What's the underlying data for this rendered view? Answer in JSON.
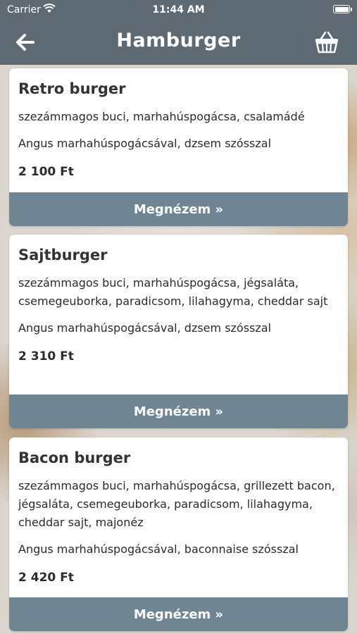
{
  "status_bar": {
    "carrier": "Carrier",
    "time": "11:44 AM"
  },
  "header": {
    "title": "Hamburger",
    "back_icon": "arrow-left-icon",
    "cart_icon": "basket-icon",
    "background_color": "#5d6a73"
  },
  "accent_button_color": "#6f8594",
  "products": [
    {
      "name": "Retro burger",
      "ingredients": "szezámmagos buci, marhahúspogácsa, csalamádé",
      "description": "Angus marhahúspogácsával, dzsem szósszal",
      "price": "2 100 Ft",
      "button_label": "Megnézem »"
    },
    {
      "name": "Sajtburger",
      "ingredients": "szezámmagos buci, marhahúspogácsa, jégsaláta, csemegeuborka, paradicsom, lilahagyma, cheddar sajt",
      "description": "Angus marhahúspogácsával, dzsem szósszal",
      "price": "2 310 Ft",
      "button_label": "Megnézem »"
    },
    {
      "name": "Bacon burger",
      "ingredients": "szezámmagos buci, marhahúspogácsa, grillezett bacon, jégsaláta, csemegeuborka, paradicsom, lilahagyma, cheddar sajt, majonéz",
      "description": "Angus marhahúspogácsával, baconnaise szósszal",
      "price": "2 420 Ft",
      "button_label": "Megnézem »"
    }
  ]
}
